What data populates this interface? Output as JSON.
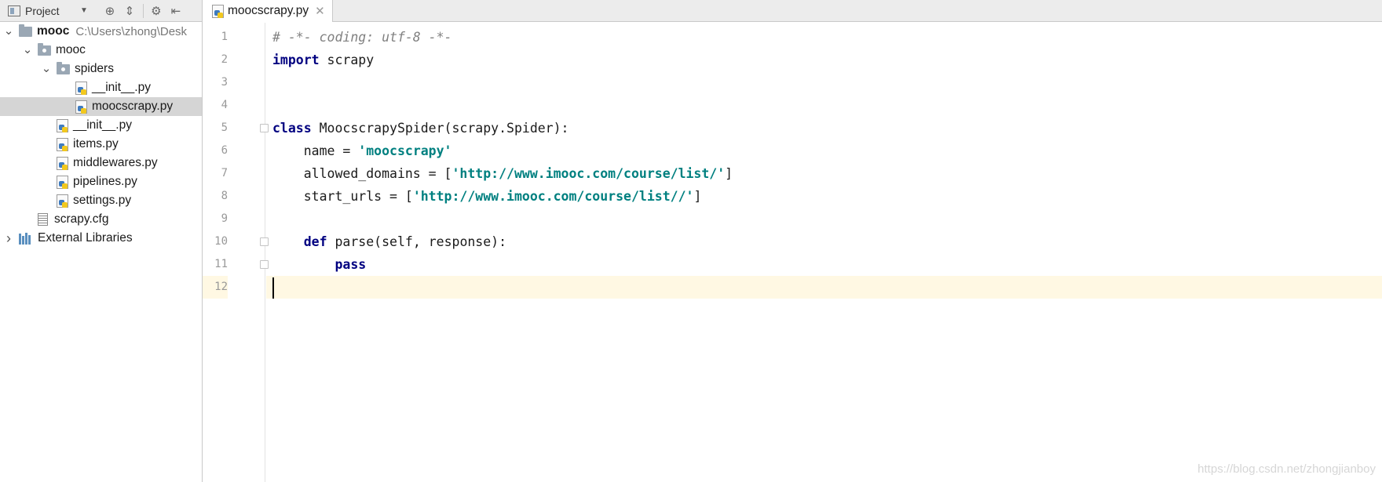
{
  "project_panel": {
    "title": "Project",
    "toolbar_icons": [
      "project-icon",
      "dropdown-icon",
      "locate-icon",
      "collapse-icon",
      "gear-icon",
      "hide-icon"
    ],
    "tree": [
      {
        "depth": 0,
        "type": "folder",
        "expanded": true,
        "label": "mooc",
        "path": "C:\\Users\\zhong\\Desk"
      },
      {
        "depth": 1,
        "type": "package",
        "expanded": true,
        "label": "mooc"
      },
      {
        "depth": 2,
        "type": "package",
        "expanded": true,
        "label": "spiders"
      },
      {
        "depth": 3,
        "type": "python",
        "label": "__init__.py"
      },
      {
        "depth": 3,
        "type": "python",
        "label": "moocscrapy.py",
        "selected": true
      },
      {
        "depth": 2,
        "type": "python",
        "label": "__init__.py"
      },
      {
        "depth": 2,
        "type": "python",
        "label": "items.py"
      },
      {
        "depth": 2,
        "type": "python",
        "label": "middlewares.py"
      },
      {
        "depth": 2,
        "type": "python",
        "label": "pipelines.py"
      },
      {
        "depth": 2,
        "type": "python",
        "label": "settings.py"
      },
      {
        "depth": 1,
        "type": "config",
        "label": "scrapy.cfg"
      },
      {
        "depth": 0,
        "type": "library",
        "expanded": false,
        "label": "External Libraries"
      }
    ]
  },
  "editor": {
    "active_tab": "moocscrapy.py",
    "current_line": 12,
    "lines": [
      [
        {
          "t": "# -*- coding: utf-8 -*-",
          "c": "cm"
        }
      ],
      [
        {
          "t": "import",
          "c": "kw"
        },
        {
          "t": " scrapy",
          "c": ""
        }
      ],
      [],
      [],
      [
        {
          "t": "class",
          "c": "kw"
        },
        {
          "t": " MoocscrapySpider(scrapy.Spider):",
          "c": ""
        }
      ],
      [
        {
          "t": "    name = ",
          "c": ""
        },
        {
          "t": "'moocscrapy'",
          "c": "str"
        }
      ],
      [
        {
          "t": "    allowed_domains = [",
          "c": ""
        },
        {
          "t": "'http://www.imooc.com/course/list/'",
          "c": "str"
        },
        {
          "t": "]",
          "c": ""
        }
      ],
      [
        {
          "t": "    start_urls = [",
          "c": ""
        },
        {
          "t": "'http://www.imooc.com/course/list//'",
          "c": "str"
        },
        {
          "t": "]",
          "c": ""
        }
      ],
      [],
      [
        {
          "t": "    ",
          "c": ""
        },
        {
          "t": "def",
          "c": "kw"
        },
        {
          "t": " parse(self, response):",
          "c": ""
        }
      ],
      [
        {
          "t": "        ",
          "c": ""
        },
        {
          "t": "pass",
          "c": "kw"
        }
      ],
      []
    ],
    "fold_lines": [
      5,
      10,
      11
    ]
  },
  "watermark": "https://blog.csdn.net/zhongjianboy"
}
